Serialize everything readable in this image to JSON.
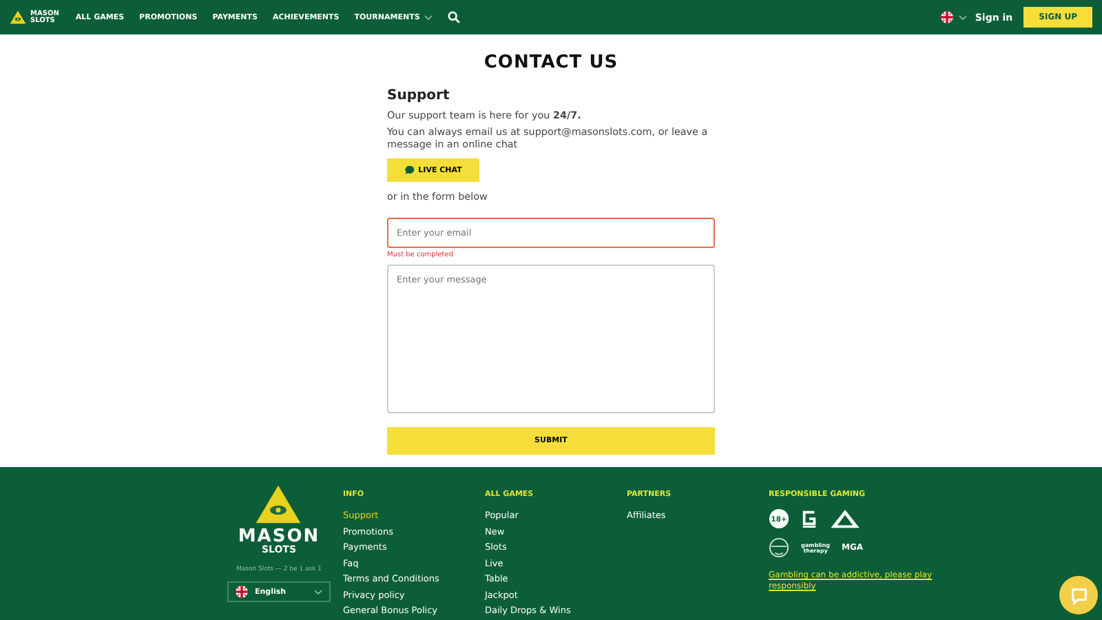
{
  "header": {
    "logo": {
      "line1": "MASON",
      "line2": "SLOTS"
    },
    "nav": [
      {
        "label": "ALL GAMES",
        "dropdown": false
      },
      {
        "label": "PROMOTIONS",
        "dropdown": false
      },
      {
        "label": "PAYMENTS",
        "dropdown": false
      },
      {
        "label": "ACHIEVEMENTS",
        "dropdown": false
      },
      {
        "label": "TOURNAMENTS",
        "dropdown": true
      }
    ],
    "sign_in": "Sign in",
    "sign_up": "SIGN UP"
  },
  "page": {
    "title": "CONTACT US",
    "heading": "Support",
    "line1": "Our support team is here for you **24/7.**",
    "line2": "You can always email us at support@masonslots.com, or leave a message in an online chat",
    "live_chat": "LIVE CHAT",
    "or_text": "or in the form below",
    "email": {
      "placeholder": "Enter your email",
      "error": "Must be completed",
      "invalid": true
    },
    "message": {
      "placeholder": "Enter your message"
    },
    "submit": "SUBMIT"
  },
  "footer": {
    "logo": {
      "line1": "MASON",
      "line2": "SLOTS"
    },
    "tagline": "Mason Slots — 2 be 1 ask 1",
    "language": "English",
    "columns": [
      {
        "title": "INFO",
        "links": [
          {
            "label": "Support",
            "selected": true
          },
          {
            "label": "Promotions",
            "selected": false
          },
          {
            "label": "Payments",
            "selected": false
          },
          {
            "label": "Faq",
            "selected": false
          },
          {
            "label": "Terms and Conditions",
            "selected": false
          },
          {
            "label": "Privacy policy",
            "selected": false
          },
          {
            "label": "General Bonus Policy",
            "selected": false
          }
        ]
      },
      {
        "title": "ALL GAMES",
        "links": [
          {
            "label": "Popular",
            "selected": false
          },
          {
            "label": "New",
            "selected": false
          },
          {
            "label": "Slots",
            "selected": false
          },
          {
            "label": "Live",
            "selected": false
          },
          {
            "label": "Table",
            "selected": false
          },
          {
            "label": "Jackpot",
            "selected": false
          },
          {
            "label": "Daily Drops & Wins",
            "selected": false
          }
        ]
      },
      {
        "title": "PARTNERS",
        "links": [
          {
            "label": "Affiliates",
            "selected": false
          }
        ]
      }
    ],
    "responsible": {
      "title": "RESPONSIBLE GAMING",
      "badge_18": "18+",
      "therapy": "gambling therapy",
      "mga": "MGA",
      "note": "Gambling can be addictive, please play responsibly"
    }
  }
}
